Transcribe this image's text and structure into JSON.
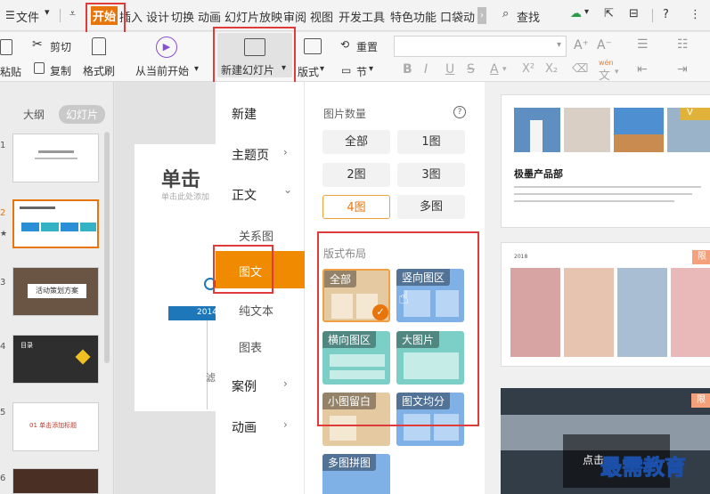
{
  "menubar": {
    "items": [
      "文件",
      "开始",
      "插入",
      "设计",
      "切换",
      "动画",
      "幻灯片放映",
      "审阅",
      "视图",
      "开发工具",
      "特色功能",
      "口袋动"
    ],
    "search": "查找",
    "help": "?"
  },
  "ribbon": {
    "paste": "粘贴",
    "cut": "剪切",
    "copy": "复制",
    "format_painter": "格式刷",
    "from_current": "从当前开始",
    "new_slide": "新建幻灯片",
    "layout": "版式",
    "reset": "重置",
    "section": "节",
    "font_buttons": [
      "B",
      "I",
      "U",
      "S",
      "A",
      "X²",
      "X₂"
    ],
    "grow": "A⁺",
    "shrink": "A⁻",
    "wen": "文",
    "wen_top": "wén"
  },
  "leftpane": {
    "tabs": [
      "大纲",
      "幻灯片"
    ],
    "slides": [
      {
        "num": "1",
        "title": ""
      },
      {
        "num": "2",
        "title": ""
      },
      {
        "num": "3",
        "title": "活动策划方案"
      },
      {
        "num": "4",
        "title": "目录"
      },
      {
        "num": "5",
        "title": "01 单击添加标题"
      },
      {
        "num": "6",
        "title": ""
      }
    ]
  },
  "canvas": {
    "title": "单击",
    "subtitle": "单击此处添加",
    "year": "2014",
    "side": "滤"
  },
  "menu1": {
    "items": [
      {
        "label": "新建",
        "sub": false,
        "chev": ""
      },
      {
        "label": "主题页",
        "sub": false,
        "chev": "›"
      },
      {
        "label": "正文",
        "sub": false,
        "chev": "⌄"
      },
      {
        "label": "关系图",
        "sub": true,
        "chev": ""
      },
      {
        "label": "图文",
        "sub": true,
        "chev": ""
      },
      {
        "label": "纯文本",
        "sub": true,
        "chev": ""
      },
      {
        "label": "图表",
        "sub": true,
        "chev": ""
      },
      {
        "label": "案例",
        "sub": false,
        "chev": "›"
      },
      {
        "label": "动画",
        "sub": false,
        "chev": "›"
      }
    ]
  },
  "menu2": {
    "count_title": "图片数量",
    "help": "?",
    "counts": [
      "全部",
      "1图",
      "2图",
      "3图",
      "4图",
      "多图"
    ],
    "layout_title": "版式布局",
    "layouts": [
      "全部",
      "竖向图区",
      "横向图区",
      "大图片",
      "小图留白",
      "图文均分",
      "多图拼图"
    ]
  },
  "gallery": {
    "card1_title": "极墨产品部",
    "card1_tag": "V",
    "card2_tag": "限",
    "card3_tag": "限",
    "card3_text": "点击",
    "card2_caption": "2018"
  },
  "watermark": "最需教育",
  "colors": {
    "accent": "#e8740c",
    "red_box": "#e03b3b",
    "selected_bg": "#f08a00"
  }
}
